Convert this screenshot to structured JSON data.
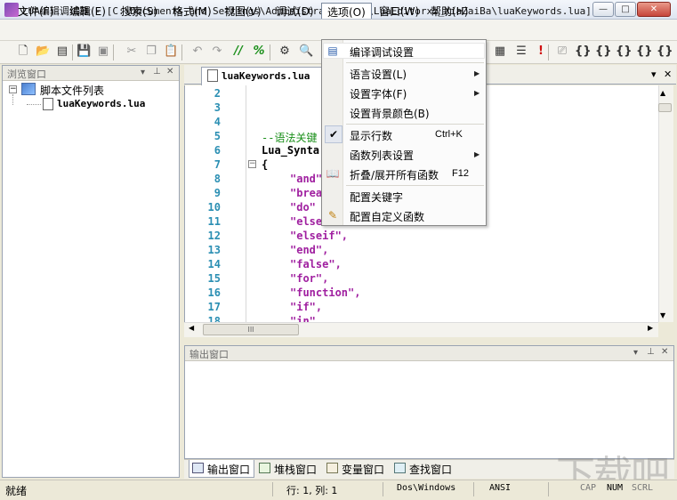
{
  "window": {
    "title": "LUA编辑调试器 - [C:\\Documents and Settings\\Administrator\\桌面\\LuaEditorxz_XiaZaiBa\\luaKeywords.lua]",
    "controls": {
      "minimize": "—",
      "maximize": "□",
      "close": "✕"
    }
  },
  "menubar": {
    "items": [
      {
        "label": "文件(F)"
      },
      {
        "label": "编辑(E)"
      },
      {
        "label": "搜索(S)"
      },
      {
        "label": "格式(M)"
      },
      {
        "label": "视图(V)"
      },
      {
        "label": "调试(D)"
      },
      {
        "label": "选项(O)"
      },
      {
        "label": "窗口(W)"
      },
      {
        "label": "帮助(H)"
      }
    ]
  },
  "toolbar": {
    "icons": [
      "new-file-icon",
      "open-folder-icon",
      "open-project-icon",
      "save-icon",
      "save-all-icon",
      "find-icon",
      "cut-icon",
      "copy-icon",
      "paste-icon",
      "undo-icon",
      "redo-icon",
      "comment-icon",
      "uncomment-icon",
      "debug-icon"
    ],
    "right_icons": [
      "breakpoint-icon",
      "step-icon",
      "stop-icon",
      "watch-icon",
      "fold-icon",
      "step-into-icon",
      "step-over-icon",
      "step-out-icon"
    ]
  },
  "left_panel": {
    "title": "浏览窗口",
    "root_label": "脚本文件列表",
    "file_label": "luaKeywords.lua",
    "pin": "⊥",
    "close": "✕"
  },
  "editor": {
    "tab_label": "luaKeywords.lua",
    "line_numbers": [
      "2",
      "3",
      "4",
      "5",
      "6",
      "7",
      "8",
      "9",
      "10",
      "11",
      "12",
      "13",
      "14",
      "15",
      "16",
      "17",
      "18"
    ],
    "code": {
      "comment": "--语法关键",
      "ident": "Lua_Synta",
      "brace": "{",
      "strings": [
        "\"and\"",
        "\"brea",
        "\"do\"",
        "\"else",
        "\"elseif\",",
        "\"end\",",
        "\"false\",",
        "\"for\",",
        "\"function\",",
        "\"if\",",
        "\"in\""
      ]
    },
    "tab_menu": "▾",
    "tab_close": "✕",
    "hscroll_grip": "III"
  },
  "output_panel": {
    "title": "输出窗口",
    "dropdown": "▾",
    "pin": "⊥",
    "close": "✕"
  },
  "bottom_tabs": [
    {
      "label": "输出窗口"
    },
    {
      "label": "堆栈窗口"
    },
    {
      "label": "变量窗口"
    },
    {
      "label": "查找窗口"
    }
  ],
  "statusbar": {
    "ready": "就绪",
    "position": "行: 1, 列: 1",
    "line_ending": "Dos\\Windows",
    "encoding": "ANSI",
    "caps": "CAP",
    "num": "NUM",
    "scrl": "SCRL"
  },
  "options_menu": {
    "items": [
      {
        "label": "编译调试设置",
        "icon": "compile-settings-icon",
        "submenu": false,
        "checked": false
      },
      {
        "label": "语言设置(L)",
        "submenu": true
      },
      {
        "label": "设置字体(F)",
        "submenu": true
      },
      {
        "label": "设置背景颜色(B)",
        "submenu": false
      },
      {
        "label": "显示行数",
        "shortcut": "Ctrl+K",
        "checked": true
      },
      {
        "label": "函数列表设置",
        "submenu": true
      },
      {
        "label": "折叠/展开所有函数",
        "shortcut": "F12",
        "icon": "fold-all-icon"
      },
      {
        "label": "配置关键字"
      },
      {
        "label": "配置自定义函数",
        "icon": "custom-function-icon"
      }
    ],
    "check_mark": "✔",
    "submenu_arrow": "▶"
  },
  "watermark": "下载吧",
  "colors": {
    "line_number": "#2b8fb3",
    "string": "#a020a0",
    "comment": "#1a8f1a"
  }
}
